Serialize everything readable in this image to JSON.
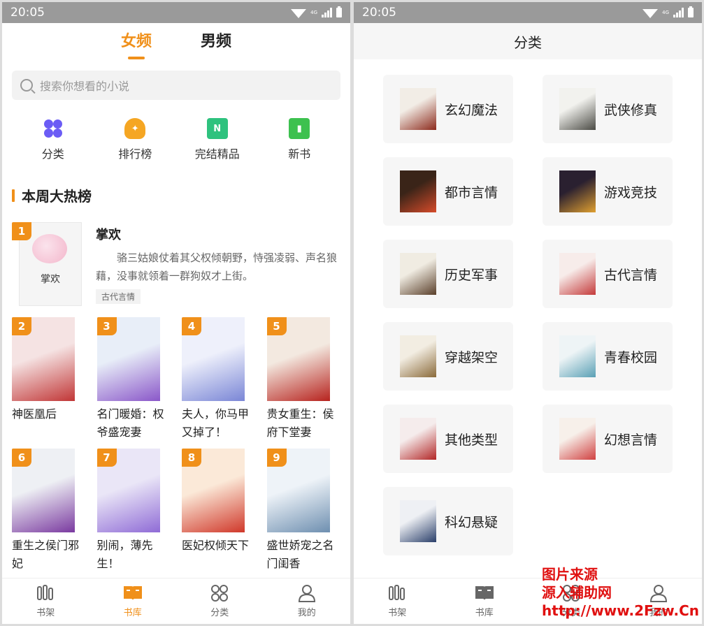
{
  "status": {
    "time": "20:05",
    "net": "4G"
  },
  "left": {
    "tabs": [
      {
        "label": "女频",
        "active": true
      },
      {
        "label": "男频",
        "active": false
      }
    ],
    "search_placeholder": "搜索你想看的小说",
    "quick": [
      {
        "label": "分类",
        "icon": "category-icon"
      },
      {
        "label": "排行榜",
        "icon": "trophy-icon"
      },
      {
        "label": "完结精品",
        "icon": "finished-book-icon"
      },
      {
        "label": "新书",
        "icon": "new-book-icon"
      }
    ],
    "section_title": "本周大热榜",
    "top1": {
      "rank": "1",
      "cover_text": "掌欢",
      "title": "掌欢",
      "desc": "骆三姑娘仗着其父权倾朝野，恃强凌弱、声名狼藉，没事就领着一群狗奴才上街。",
      "tag": "古代言情"
    },
    "books": [
      {
        "rank": "2",
        "title": "神医凰后",
        "color1": "#f5e3e3",
        "color2": "#c13636"
      },
      {
        "rank": "3",
        "title": "名门暖婚：权爷盛宠妻",
        "color1": "#e8eef8",
        "color2": "#8a57c9"
      },
      {
        "rank": "4",
        "title": "夫人，你马甲又掉了！",
        "color1": "#eef0fb",
        "color2": "#7a86d6"
      },
      {
        "rank": "5",
        "title": "贵女重生：侯府下堂妻",
        "color1": "#f3e9e0",
        "color2": "#b7231e"
      },
      {
        "rank": "6",
        "title": "重生之侯门邪妃",
        "color1": "#eef0f4",
        "color2": "#7a3aa0"
      },
      {
        "rank": "7",
        "title": "别闹，薄先生！",
        "color1": "#eae6f7",
        "color2": "#8f6bd6"
      },
      {
        "rank": "8",
        "title": "医妃权倾天下",
        "color1": "#fbe9d8",
        "color2": "#d0382a"
      },
      {
        "rank": "9",
        "title": "盛世娇宠之名门闺香",
        "color1": "#eef3f8",
        "color2": "#6e8fb0"
      }
    ],
    "tabbar": [
      {
        "label": "书架",
        "icon": "bookshelf-icon",
        "active": false
      },
      {
        "label": "书库",
        "icon": "library-icon",
        "active": true
      },
      {
        "label": "分类",
        "icon": "category-grid-icon",
        "active": false
      },
      {
        "label": "我的",
        "icon": "profile-icon",
        "active": false
      }
    ]
  },
  "right": {
    "title": "分类",
    "categories": [
      {
        "label": "玄幻魔法",
        "c1": "#f2ede6",
        "c2": "#8c2a1c"
      },
      {
        "label": "武侠修真",
        "c1": "#f2f2ee",
        "c2": "#4a4a44"
      },
      {
        "label": "都市言情",
        "c1": "#3a2418",
        "c2": "#d64b2a"
      },
      {
        "label": "游戏竞技",
        "c1": "#2a2030",
        "c2": "#e0a030"
      },
      {
        "label": "历史军事",
        "c1": "#f0ece2",
        "c2": "#5a3f2a"
      },
      {
        "label": "古代言情",
        "c1": "#f7ecea",
        "c2": "#c43a3a"
      },
      {
        "label": "穿越架空",
        "c1": "#f2ede2",
        "c2": "#8a6a3a"
      },
      {
        "label": "青春校园",
        "c1": "#eef4f6",
        "c2": "#5aa0b5"
      },
      {
        "label": "其他类型",
        "c1": "#f5ecec",
        "c2": "#b22626"
      },
      {
        "label": "幻想言情",
        "c1": "#f7f0ea",
        "c2": "#d04040"
      },
      {
        "label": "科幻悬疑",
        "c1": "#eef0f4",
        "c2": "#2a3f6a"
      }
    ],
    "tabbar": [
      {
        "label": "书架",
        "icon": "bookshelf-icon"
      },
      {
        "label": "书库",
        "icon": "library-icon"
      },
      {
        "label": "分类",
        "icon": "category-grid-icon"
      },
      {
        "label": "我的",
        "icon": "profile-icon"
      }
    ]
  },
  "watermark": {
    "line1": "图片来源",
    "line2": "源入辅助网",
    "line3": "http://www.2Fzw.Cn"
  }
}
